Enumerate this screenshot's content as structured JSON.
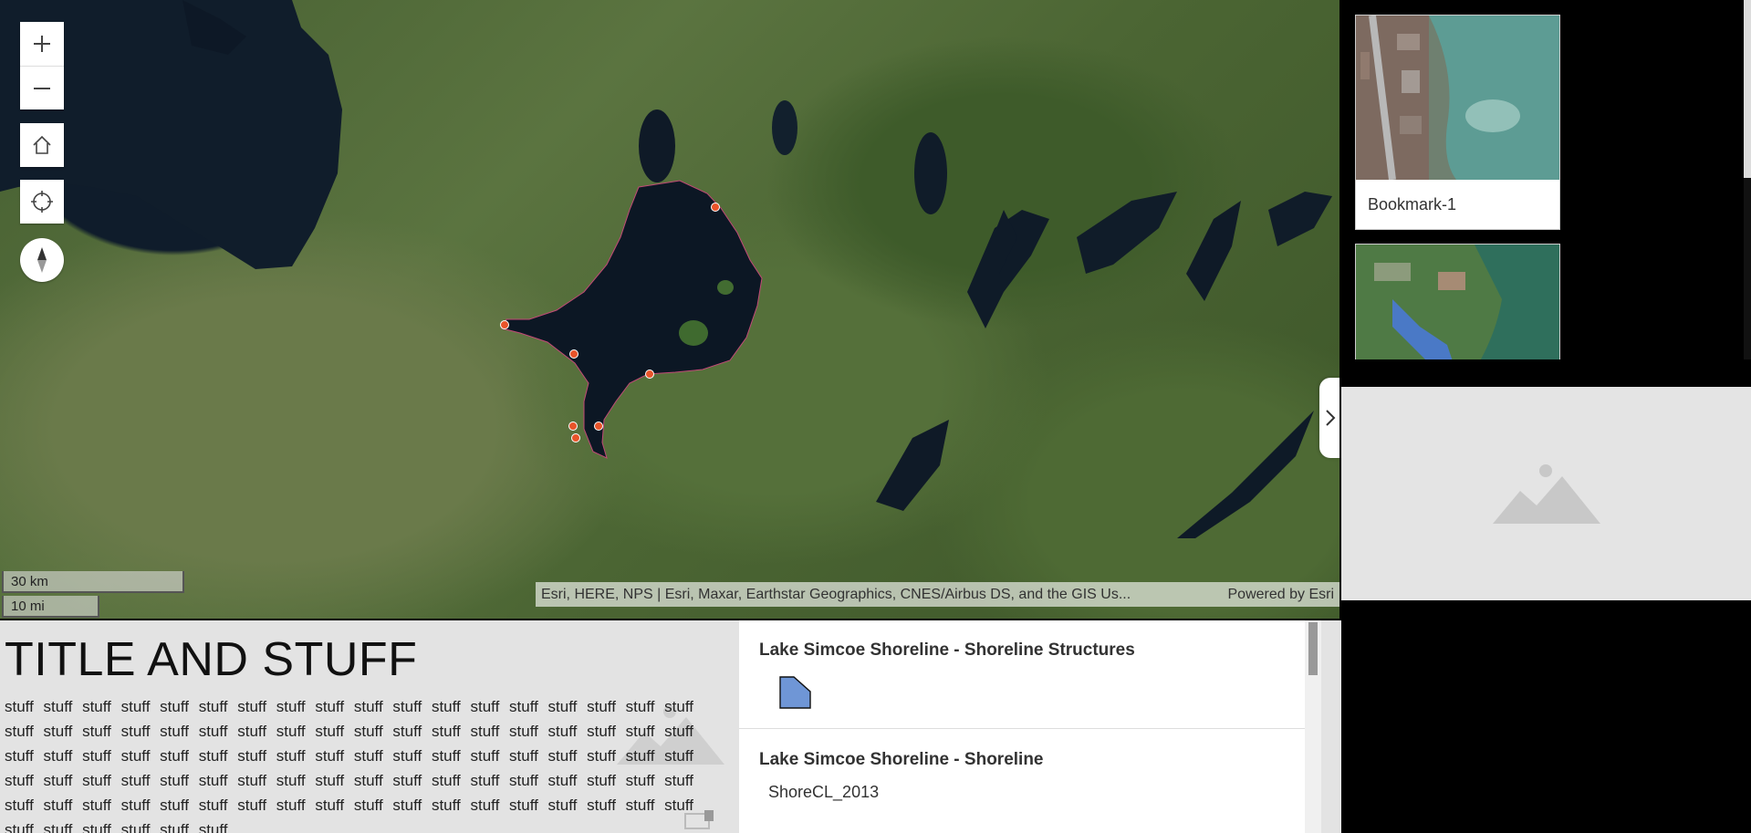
{
  "map": {
    "zoom_in_icon": "plus-icon",
    "zoom_out_icon": "minus-icon",
    "home_icon": "home-icon",
    "locate_icon": "crosshair-icon",
    "compass_icon": "compass-icon",
    "scale_km": "30 km",
    "scale_mi": "10 mi",
    "attribution": "Esri, HERE, NPS | Esri, Maxar, Earthstar Geographics, CNES/Airbus DS, and the GIS Us...",
    "powered_by": "Powered by Esri",
    "collapse_icon": "chevron-right-icon",
    "marker_color": "#e8542a"
  },
  "bookmarks": {
    "items": [
      {
        "label": "Bookmark-1"
      },
      {
        "label": ""
      }
    ]
  },
  "text_panel": {
    "title": "TITLE AND STUFF",
    "body": "stuff stuff stuff stuff stuff stuff stuff stuff stuff stuff stuff stuff stuff stuff stuff stuff stuff stuff stuff stuff stuff stuff stuff stuff stuff stuff stuff stuff stuff stuff stuff stuff stuff stuff stuff stuff stuff stuff stuff stuff stuff stuff stuff stuff stuff stuff stuff stuff stuff stuff stuff stuff stuff stuff stuff stuff stuff stuff stuff stuff stuff stuff stuff stuff stuff stuff stuff stuff stuff stuff stuff stuff stuff stuff stuff stuff stuff stuff stuff stuff stuff stuff stuff stuff stuff stuff stuff stuff stuff stuff stuff stuff stuff stuff stuff stuff"
  },
  "legend": {
    "layers": [
      {
        "title": "Lake Simcoe Shoreline - Shoreline Structures",
        "swatch_color": "#6f96d6"
      },
      {
        "title": "Lake Simcoe Shoreline - Shoreline",
        "sub": "ShoreCL_2013"
      }
    ]
  }
}
